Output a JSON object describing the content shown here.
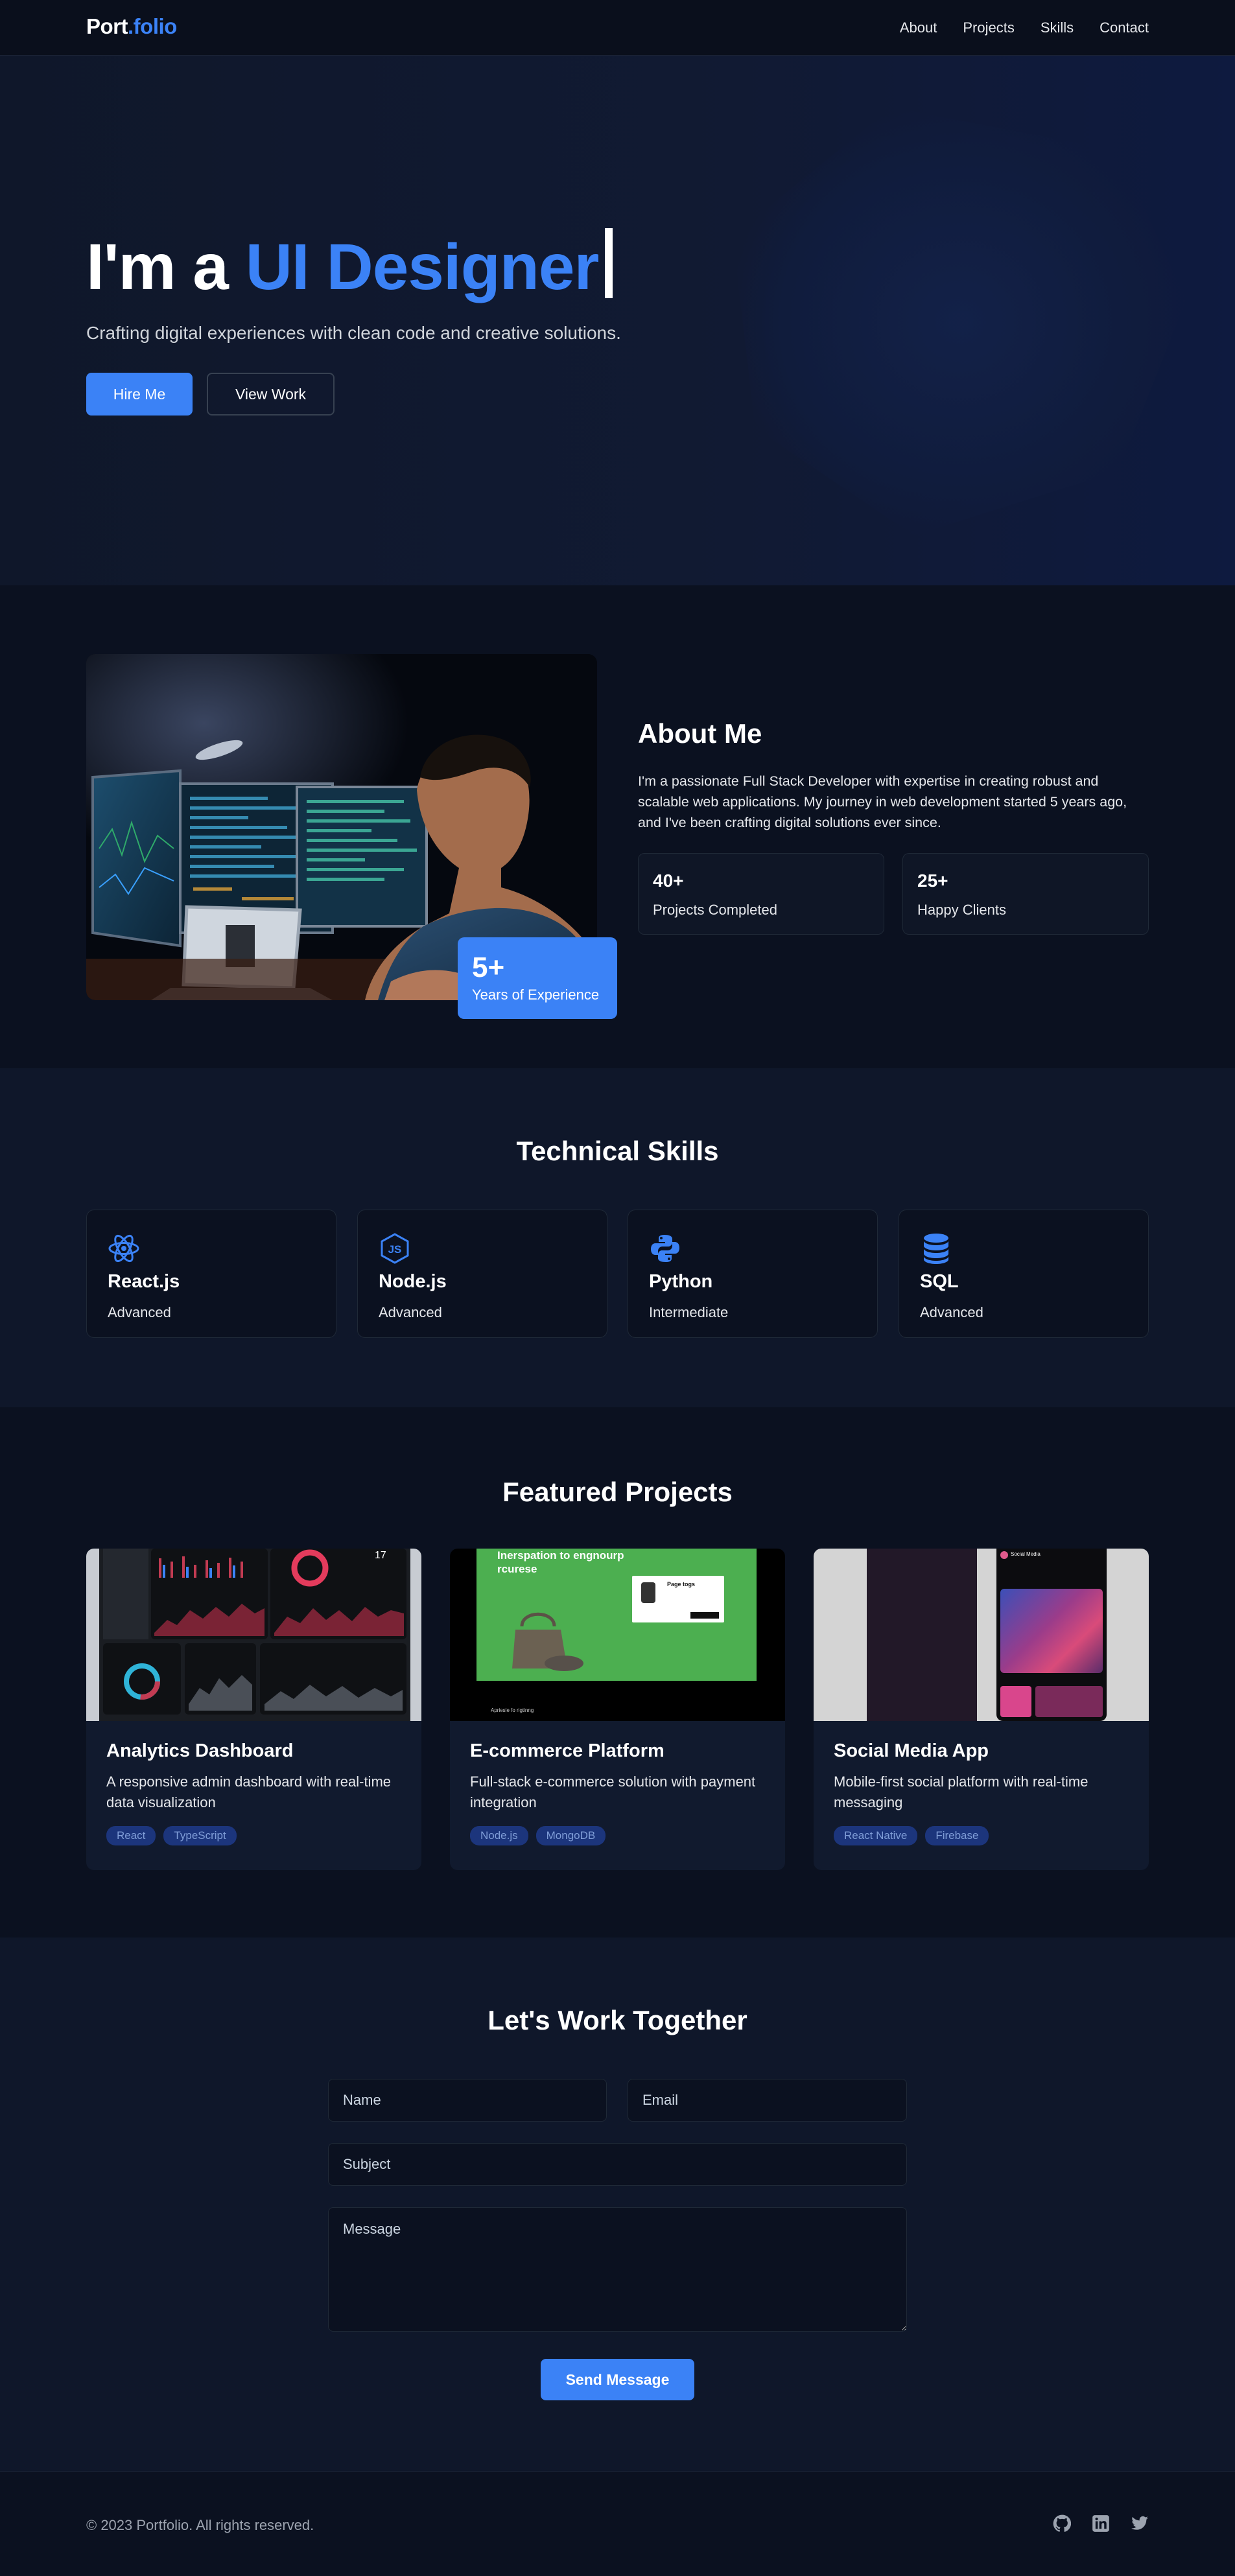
{
  "nav": {
    "logo_main": "Port",
    "logo_accent": ".folio",
    "links": [
      "About",
      "Projects",
      "Skills",
      "Contact"
    ]
  },
  "hero": {
    "prefix": "I'm a",
    "highlight": "UI Designer",
    "subtitle": "Crafting digital experiences with clean code and creative solutions.",
    "primary_button": "Hire Me",
    "secondary_button": "View Work"
  },
  "about": {
    "title": "About Me",
    "bio": "I'm a passionate Full Stack Developer with expertise in creating robust and scalable web applications. My journey in web development started 5 years ago, and I've been crafting digital solutions ever since.",
    "experience_value": "5+",
    "experience_label": "Years of Experience",
    "stats": [
      {
        "value": "40+",
        "label": "Projects Completed"
      },
      {
        "value": "25+",
        "label": "Happy Clients"
      }
    ]
  },
  "skills": {
    "title": "Technical Skills",
    "items": [
      {
        "name": "React.js",
        "level": "Advanced",
        "icon": "react-icon"
      },
      {
        "name": "Node.js",
        "level": "Advanced",
        "icon": "nodejs-icon"
      },
      {
        "name": "Python",
        "level": "Intermediate",
        "icon": "python-icon"
      },
      {
        "name": "SQL",
        "level": "Advanced",
        "icon": "database-icon"
      }
    ]
  },
  "projects": {
    "title": "Featured Projects",
    "items": [
      {
        "title": "Analytics Dashboard",
        "description": "A responsive admin dashboard with real-time data visualization",
        "tags": [
          "React",
          "TypeScript"
        ]
      },
      {
        "title": "E-commerce Platform",
        "description": "Full-stack e-commerce solution with payment integration",
        "tags": [
          "Node.js",
          "MongoDB"
        ]
      },
      {
        "title": "Social Media App",
        "description": "Mobile-first social platform with real-time messaging",
        "tags": [
          "React Native",
          "Firebase"
        ]
      }
    ],
    "ecom_thumb_heading": "Inerspation to engnourp rcurese",
    "ecom_thumb_card": "Page togs",
    "ecom_thumb_footer": "Apriesle fo rigtinng",
    "social_thumb_header": "Social Media"
  },
  "contact": {
    "title": "Let's Work Together",
    "name_placeholder": "Name",
    "email_placeholder": "Email",
    "subject_placeholder": "Subject",
    "message_placeholder": "Message",
    "submit": "Send Message"
  },
  "footer": {
    "copyright": "© 2023 Portfolio. All rights reserved.",
    "social_icons": [
      "github-icon",
      "linkedin-icon",
      "twitter-icon"
    ]
  },
  "colors": {
    "accent": "#3b82f6",
    "background": "#0b1120",
    "surface": "#0f172a"
  }
}
